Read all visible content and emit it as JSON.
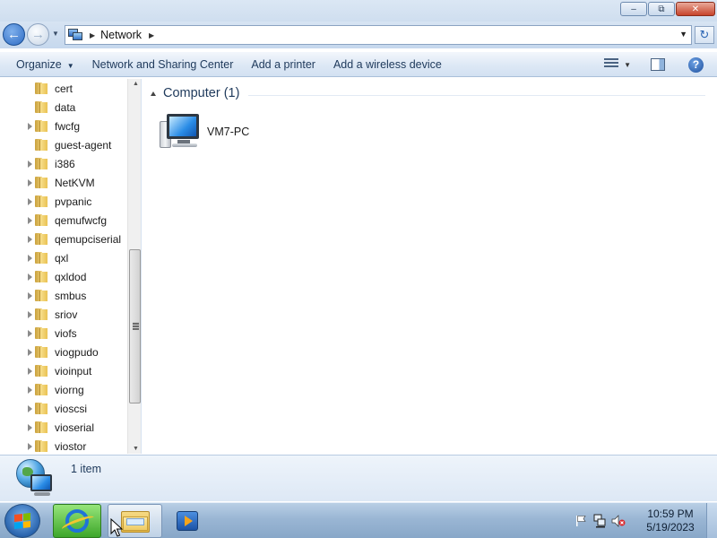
{
  "window": {
    "minimize_label": "–",
    "maximize_label": "⧉",
    "close_label": "✕"
  },
  "address": {
    "location": "Network",
    "back_label": "←",
    "forward_label": "→",
    "refresh_label": "↻"
  },
  "toolbar": {
    "organize": "Organize",
    "network_sharing": "Network and Sharing Center",
    "add_printer": "Add a printer",
    "add_wireless": "Add a wireless device",
    "help_label": "?"
  },
  "nav_tree": {
    "items": [
      {
        "label": "cert",
        "expandable": false
      },
      {
        "label": "data",
        "expandable": false
      },
      {
        "label": "fwcfg",
        "expandable": true
      },
      {
        "label": "guest-agent",
        "expandable": false
      },
      {
        "label": "i386",
        "expandable": true
      },
      {
        "label": "NetKVM",
        "expandable": true
      },
      {
        "label": "pvpanic",
        "expandable": true
      },
      {
        "label": "qemufwcfg",
        "expandable": true
      },
      {
        "label": "qemupciserial",
        "expandable": true
      },
      {
        "label": "qxl",
        "expandable": true
      },
      {
        "label": "qxldod",
        "expandable": true
      },
      {
        "label": "smbus",
        "expandable": true
      },
      {
        "label": "sriov",
        "expandable": true
      },
      {
        "label": "viofs",
        "expandable": true
      },
      {
        "label": "viogpudo",
        "expandable": true
      },
      {
        "label": "vioinput",
        "expandable": true
      },
      {
        "label": "viorng",
        "expandable": true
      },
      {
        "label": "vioscsi",
        "expandable": true
      },
      {
        "label": "vioserial",
        "expandable": true
      },
      {
        "label": "viostor",
        "expandable": true
      }
    ]
  },
  "content": {
    "group_title": "Computer (1)",
    "items": [
      {
        "label": "VM7-PC",
        "icon": "computer-icon"
      }
    ]
  },
  "details": {
    "count": "1 item"
  },
  "taskbar": {
    "time": "10:59 PM",
    "date": "5/19/2023"
  }
}
